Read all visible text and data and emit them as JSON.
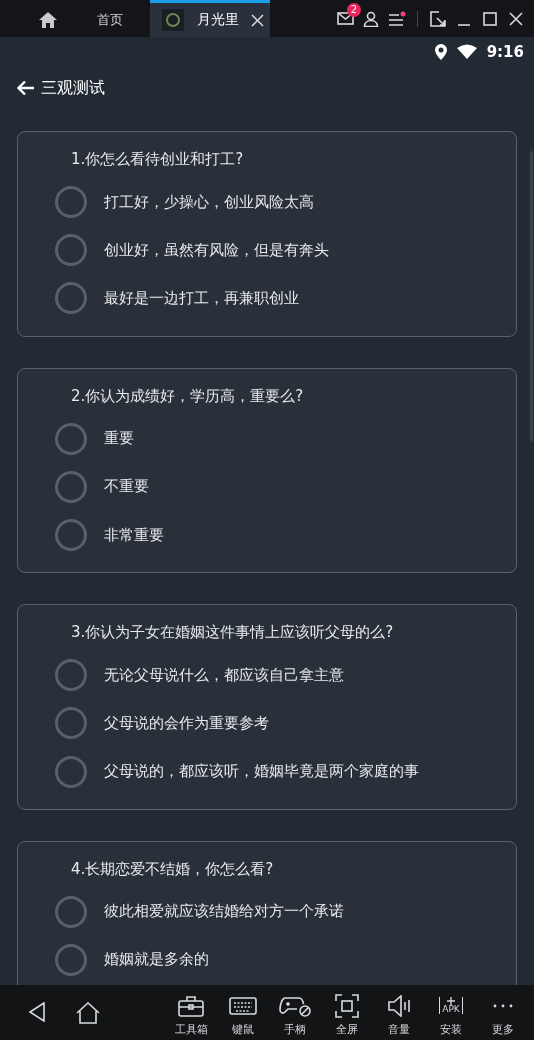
{
  "window": {
    "tabs": [
      {
        "label": "首页",
        "kind": "home",
        "selected": false
      },
      {
        "label": "月光里",
        "kind": "app",
        "selected": true,
        "closable": true
      }
    ],
    "mail_badge": "2"
  },
  "status_bar": {
    "time": "9:16"
  },
  "header": {
    "title": "三观测试"
  },
  "questions": [
    {
      "text": "1.你怎么看待创业和打工?",
      "options": [
        {
          "text": "打工好，少操心，创业风险太高",
          "selected": false
        },
        {
          "text": "创业好，虽然有风险，但是有奔头",
          "selected": false
        },
        {
          "text": "最好是一边打工，再兼职创业",
          "selected": false
        }
      ]
    },
    {
      "text": "2.你认为成绩好，学历高，重要么?",
      "options": [
        {
          "text": "重要",
          "selected": false
        },
        {
          "text": "不重要",
          "selected": false
        },
        {
          "text": "非常重要",
          "selected": false
        }
      ]
    },
    {
      "text": "3.你认为子女在婚姻这件事情上应该听父母的么?",
      "options": [
        {
          "text": "无论父母说什么，都应该自己拿主意",
          "selected": false
        },
        {
          "text": "父母说的会作为重要参考",
          "selected": false
        },
        {
          "text": "父母说的，都应该听，婚姻毕竟是两个家庭的事",
          "selected": false
        }
      ]
    },
    {
      "text": "4.长期恋爱不结婚，你怎么看?",
      "options": [
        {
          "text": "彼此相爱就应该结婚给对方一个承诺",
          "selected": false
        },
        {
          "text": "婚姻就是多余的",
          "selected": false
        }
      ]
    }
  ],
  "toolbar": [
    {
      "kind": "toolbox",
      "label": "工具箱"
    },
    {
      "kind": "keyboard",
      "label": "键鼠"
    },
    {
      "kind": "gamepad",
      "label": "手柄"
    },
    {
      "kind": "fullscreen",
      "label": "全屏"
    },
    {
      "kind": "volume",
      "label": "音量"
    },
    {
      "kind": "apk",
      "label": "安装",
      "icon_text": "APK"
    },
    {
      "kind": "more",
      "label": "更多"
    }
  ]
}
